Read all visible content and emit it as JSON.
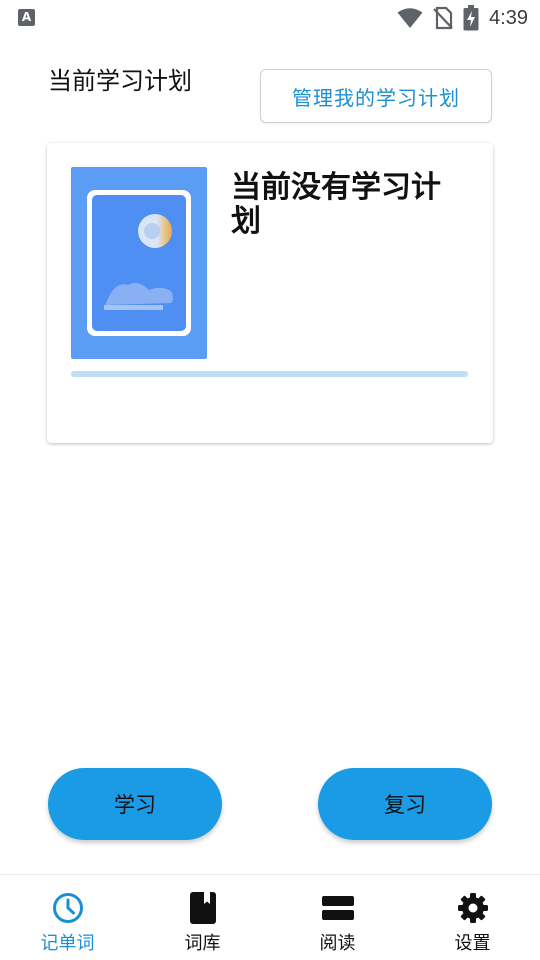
{
  "status_bar": {
    "time": "4:39",
    "left_icon_letter": "A"
  },
  "header": {
    "title": "当前学习计划",
    "manage_button": "管理我的学习计划"
  },
  "plan_card": {
    "title": "当前没有学习计划",
    "progress_fraction": 0
  },
  "actions": {
    "study": "学习",
    "review": "复习"
  },
  "bottom_nav": {
    "items": [
      {
        "label": "记单词",
        "icon": "clock-icon",
        "active": true
      },
      {
        "label": "词库",
        "icon": "book-icon",
        "active": false
      },
      {
        "label": "阅读",
        "icon": "stack-icon",
        "active": false
      },
      {
        "label": "设置",
        "icon": "gear-icon",
        "active": false
      }
    ]
  },
  "colors": {
    "accent": "#1b9be6",
    "accent_text": "#1a8fd6",
    "progress_track": "#bde0f7"
  }
}
